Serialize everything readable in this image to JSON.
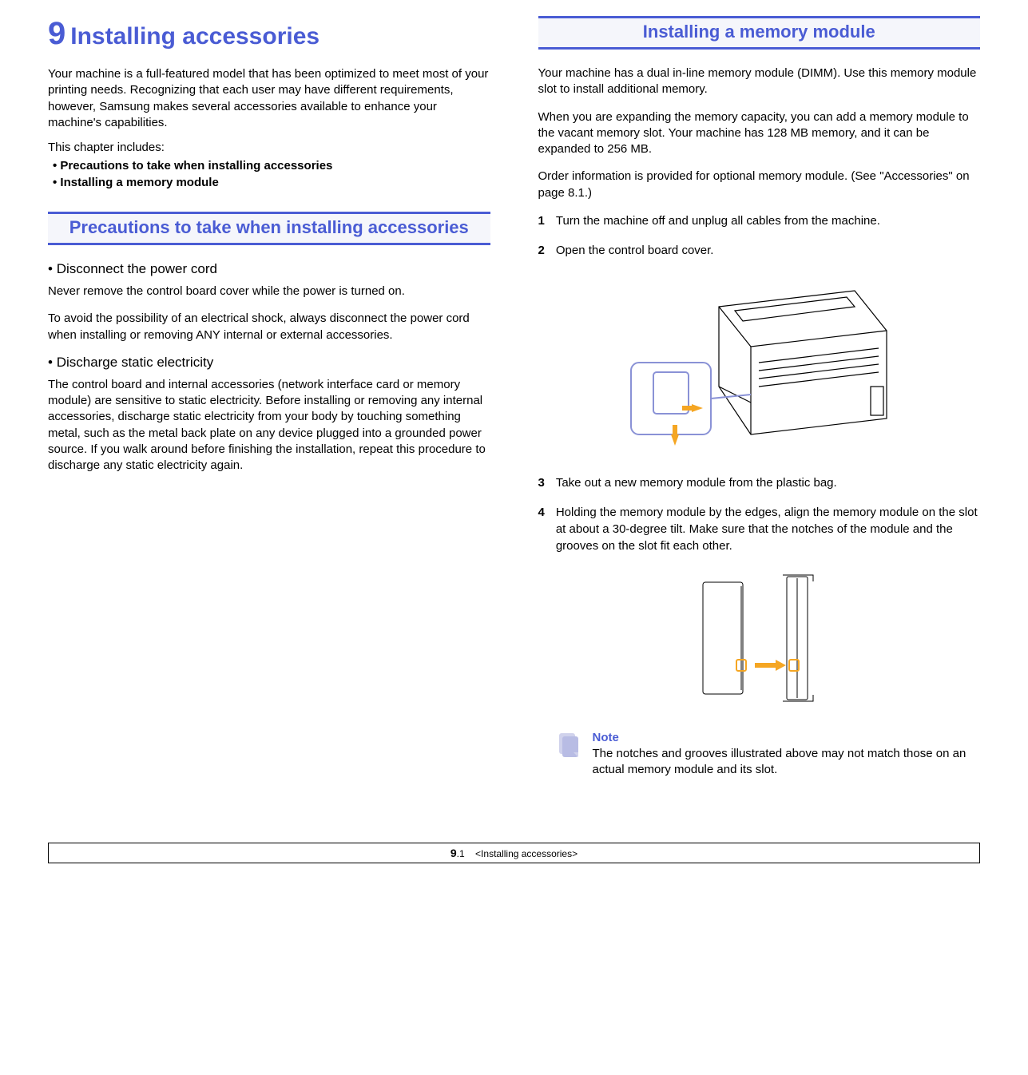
{
  "chapter": {
    "number": "9",
    "title": "Installing accessories"
  },
  "left": {
    "intro": "Your machine is a full-featured model that has been optimized to meet most of your printing needs. Recognizing that each user may have different requirements, however, Samsung makes several accessories available to enhance your machine's capabilities.",
    "includes_label": "This chapter includes:",
    "includes": [
      "Precautions to take when installing accessories",
      "Installing a memory module"
    ],
    "section1": {
      "heading": "Precautions to take when installing accessories",
      "sub1": {
        "bullet": "Disconnect the power cord",
        "p1": "Never remove the control board cover while the power is turned on.",
        "p2": "To avoid the possibility of an electrical shock, always disconnect the power cord when installing or removing ANY internal or external accessories."
      },
      "sub2": {
        "bullet": "Discharge static electricity",
        "p1": "The control board and internal accessories (network interface card or memory module) are sensitive to static electricity. Before installing or removing any internal accessories, discharge static electricity from your body by touching something metal, such as the metal back plate on any device plugged into a grounded power source. If you walk around before finishing the installation, repeat this procedure to discharge any static electricity again."
      }
    }
  },
  "right": {
    "section2": {
      "heading": "Installing a memory module",
      "p1": "Your machine has a dual in-line memory module (DIMM). Use this memory module slot to install additional memory.",
      "p2": "When you are expanding the memory capacity, you can add a memory module to the vacant memory slot. Your machine has 128 MB memory, and it can be expanded to 256 MB.",
      "p3": "Order information is provided for optional memory module. (See \"Accessories\" on page 8.1.)",
      "steps": {
        "s1": {
          "num": "1",
          "text": "Turn the machine off and unplug all cables from the machine."
        },
        "s2": {
          "num": "2",
          "text": "Open the control board cover."
        },
        "s3": {
          "num": "3",
          "text": "Take out a new memory module from the plastic bag."
        },
        "s4": {
          "num": "4",
          "text": "Holding the memory module by the edges, align the memory module on the slot at about a 30-degree tilt. Make sure that the notches of the module and the grooves on the slot fit each other."
        }
      },
      "note": {
        "title": "Note",
        "text": "The notches and grooves illustrated above may not match those on an actual memory module and its slot."
      }
    }
  },
  "footer": {
    "page_chapter": "9",
    "page_dot": ".",
    "page_num": "1",
    "title": "<Installing accessories>"
  }
}
